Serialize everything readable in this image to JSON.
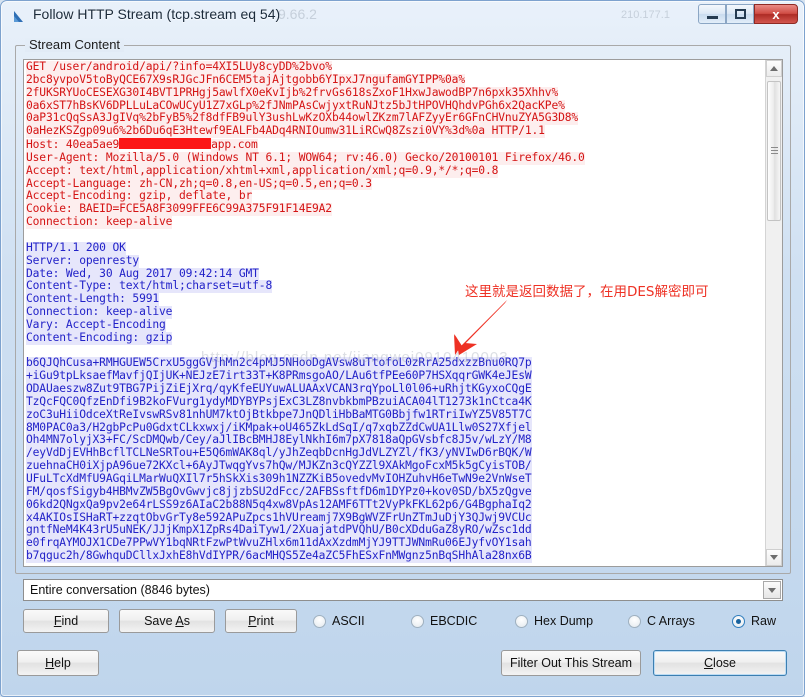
{
  "window": {
    "title": "Follow HTTP Stream (tcp.stream eq 54)",
    "icon": "wireshark-shark-fin-icon",
    "buttons": {
      "minimize": "minimize-icon",
      "maximize": "maximize-icon",
      "close": "x"
    },
    "titlebar_watermark_left": "9.66.2",
    "titlebar_watermark_right": "210.177.1"
  },
  "groupbox": {
    "label": "Stream Content"
  },
  "annotation": {
    "text": "这里就是返回数据了，在用DES解密即可",
    "color": "#ee3124",
    "arrow": "red-arrow-pointing-down-left"
  },
  "watermark": {
    "line1": "http://blog.csdn.net/jiangwei0910410003"
  },
  "stream": {
    "request_color": "#d41414",
    "response_color": "#2222c8",
    "request_lines": [
      "GET /user/android/api/?info=4XI5LUy8cyDD%2bvo%",
      "2bc8yvpoV5toByQCE67X9sRJGcJFn6CEM5tajAjtgobb6YIpxJ7ngufamGYIPP%0a%",
      "2fUKSRYUoCESEXG30I4BVT1PRHgj5awlfX0eKvIjb%2frvGs618sZxoF1HxwJawodBP7n6pxk35Xhhv%",
      "0a6xST7hBsKV6DPLLuLaCOwUCyU1Z7xGLp%2fJNmPAsCwjyxtRuNJtz5bJtHPOVHQhdvPGh6x2QacKPe%",
      "0aP31cQqSsA3JgIVq%2bFyB5%2f8dfFB9ulY3ushLwKzOXb44owlZKzm7lAFZyyEr6GFnCHVnuZYA5G3D8%",
      "0aHezKSZgp09u6%2b6Du6qE3Htewf9EALFb4ADq4RNIOumw31LiRCwQ8Zszi0VY%3d%0a HTTP/1.1"
    ],
    "host_prefix": "Host: 40ea5ae9",
    "host_suffix": "app.com",
    "host_redacted": true,
    "request_headers": [
      "User-Agent: Mozilla/5.0 (Windows NT 6.1; WOW64; rv:46.0) Gecko/20100101 Firefox/46.0",
      "Accept: text/html,application/xhtml+xml,application/xml;q=0.9,*/*;q=0.8",
      "Accept-Language: zh-CN,zh;q=0.8,en-US;q=0.5,en;q=0.3",
      "Accept-Encoding: gzip, deflate, br",
      "Cookie: BAEID=FCE5A8F3099FFE6C99A375F91F14E9A2",
      "Connection: keep-alive"
    ],
    "response_headers": [
      "HTTP/1.1 200 OK",
      "Server: openresty",
      "Date: Wed, 30 Aug 2017 09:42:14 GMT",
      "Content-Type: text/html;charset=utf-8",
      "Content-Length: 5991",
      "Connection: keep-alive",
      "Vary: Accept-Encoding",
      "Content-Encoding: gzip"
    ],
    "response_body": [
      "b6QJQhCusa+RMHGUEW5CrxU5ggGVjhMn2c4pMJ5NHooDgAVsw8uTtofoL0zRrA25dxzzBnu0RQ7p",
      "+iGu9tpLksaefMavfjQIjUK+NEJzE7irt33T+K8PRmsgoAO/LAu6tfPEe60P7HSXqqrGWK4eJEsW",
      "ODAUaeszw8Zut9TBG7PijZiEjXrq/qyKfeEUYuwALUAAxVCAN3rqYpoLl0l06+uRhjtKGyxoCQgE",
      "TzQcFQC0QfzEnDfi9B2koFVurg1ydyMDYBYPsjExC3LZ8nvbkbmPBzuiACA04lT1273k1nCtca4K",
      "zoC3uHiiOdceXtReIvswRSv81nhUM7ktOjBtkbpe7JnQDliHbBaMTG0Bbjfw1RTriIwYZ5V85T7C",
      "8M0PAC0a3/H2gbPcPu0GdxtCLkxwxj/iKMpak+oU465ZkLdSqI/q7xqbZZdCwUA1Llw0S27Xfjel",
      "Oh4MN7olyjX3+FC/ScDMQwb/Cey/aJlIBcBMHJ8EylNkhI6m7pX7818aQpGVsbfc8J5v/wLzY/M8",
      "/eyVdDjEVHhBcflTCLNeSRTou+E5Q6mWAK8ql/yJhZeqbDcnHgJdVLZYZl/fK3/yNVIwD6rBQK/W",
      "zuehnaCH0iXjpA96ue72KXcl+6AyJTwqgYvs7hQw/MJKZn3cQYZZl9XAkMgoFcxM5k5gCyisTOB/",
      "UFuLTcXdMfU9AGqiLMarWuQXIl7r5hSkXis309h1NZZKiB5ovedvMvIOHZuhvH6eTwN9e2VnWseT",
      "FM/qosfSigyb4HBMvZW5BgOvGwvjc8jjzbSU2dFcc/2AFBSsftfD6m1DYPz0+kov0SD/bX5zQgve",
      "06kd2QNgxQa9pv2e64rLSS9z6AIaC2b88N5q4xw8VpAs12AMF6TTt2VyPkFKL62p6/G4BgphaIq2",
      "x4AKIOsISHaRT+zzqtObvGrTy8e592APuZpcs1hVUreamj7X9BgWVZFrUnZTmJuDjY3QJwj9VCUc",
      "gntfNeM4K43rU5uNEK/JJjKmpX1ZpRs4DaiTyw1/2XuajatdPVQhU/B0cXDduGaZ8yRO/wZsc1dd",
      "e0frqAYMOJX1CDe7PPwVY1bqNRtFzwPtWvuZHlx6m11dAxXzdmMjYJ9TTJWNmRu06EJyfvOY1sah",
      "b7qguc2h/8GwhquDCllxJxhE8hVdIYPR/6acMHQS5Ze4aZC5FhESxFnMWgnz5nBqSHhAla28nx6B"
    ]
  },
  "filter": {
    "selected": "Entire conversation (8846 bytes)",
    "dropdown_icon": "chevron-down-icon"
  },
  "actions": {
    "find": "Find",
    "find_mnemonic": "F",
    "save_as": "Save As",
    "print": "Print"
  },
  "formats": [
    {
      "label": "ASCII",
      "selected": false
    },
    {
      "label": "EBCDIC",
      "selected": false
    },
    {
      "label": "Hex Dump",
      "selected": false
    },
    {
      "label": "C Arrays",
      "selected": false
    },
    {
      "label": "Raw",
      "selected": true
    }
  ],
  "footer": {
    "help": "Help",
    "filter_out": "Filter Out This Stream",
    "close": "Close"
  }
}
